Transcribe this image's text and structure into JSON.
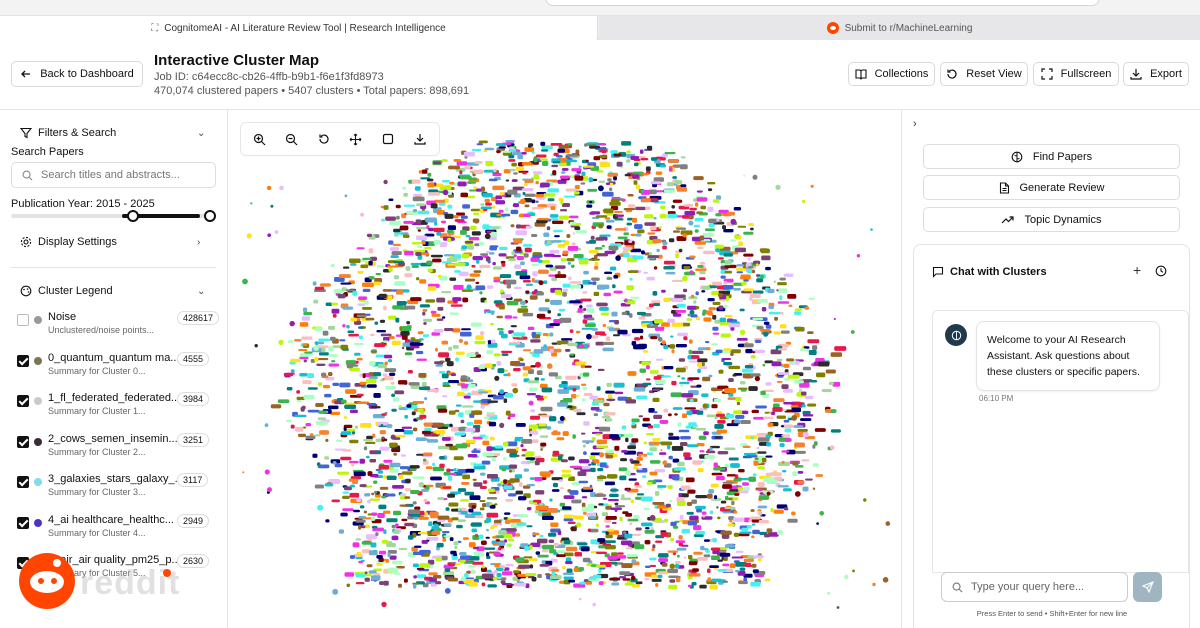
{
  "browser": {
    "tabs": [
      {
        "label": "CognitomeAI - AI Literature Review Tool | Research Intelligence",
        "active": true
      },
      {
        "label": "Submit to r/MachineLearning",
        "active": false
      }
    ]
  },
  "header": {
    "back_label": "Back to Dashboard",
    "title": "Interactive Cluster Map",
    "job_line": "Job ID: c64ecc8c-cb26-4ffb-b9b1-f6e1f3fd8973",
    "stats_line": "470,074 clustered papers • 5407 clusters • Total papers: 898,691",
    "buttons": {
      "collections": "Collections",
      "reset": "Reset View",
      "fullscreen": "Fullscreen",
      "export": "Export"
    }
  },
  "sidebar": {
    "filters_title": "Filters & Search",
    "search_label": "Search Papers",
    "search_placeholder": "Search titles and abstracts...",
    "year_label": "Publication Year: 2015 - 2025",
    "year_range": {
      "min": 2015,
      "max": 2025,
      "from": 2015,
      "to": 2025
    },
    "display_title": "Display Settings",
    "legend_title": "Cluster Legend",
    "legend": [
      {
        "name": "Noise",
        "summary": "Unclustered/noise points...",
        "count": "428617",
        "checked": false,
        "color": "#9a9a9a"
      },
      {
        "name": "0_quantum_quantum ma...",
        "summary": "Summary for Cluster 0...",
        "count": "4555",
        "checked": true,
        "color": "#7a7552"
      },
      {
        "name": "1_fl_federated_federated...",
        "summary": "Summary for Cluster 1...",
        "count": "3984",
        "checked": true,
        "color": "#c9c9c9"
      },
      {
        "name": "2_cows_semen_insemin...",
        "summary": "Summary for Cluster 2...",
        "count": "3251",
        "checked": true,
        "color": "#3a2a38"
      },
      {
        "name": "3_galaxies_stars_galaxy_...",
        "summary": "Summary for Cluster 3...",
        "count": "3117",
        "checked": true,
        "color": "#7fdcec"
      },
      {
        "name": "4_ai healthcare_healthc...",
        "summary": "Summary for Cluster 4...",
        "count": "2949",
        "checked": true,
        "color": "#4a35c9"
      },
      {
        "name": "5_air_air quality_pm25_p...",
        "summary": "Summary for Cluster 5...",
        "count": "2630",
        "checked": true,
        "color": "#d9a34a"
      }
    ]
  },
  "map": {
    "tools": [
      "zoom-in",
      "zoom-out",
      "rotate-reset",
      "pan",
      "select-box",
      "download"
    ],
    "palette": [
      "#e6194b",
      "#3cb44b",
      "#ffe119",
      "#4363d8",
      "#f58231",
      "#911eb4",
      "#46f0f0",
      "#f032e6",
      "#bcf60c",
      "#fabebe",
      "#008080",
      "#e6beff",
      "#9a6324",
      "#800000",
      "#aaffc3",
      "#808000",
      "#000075",
      "#808080",
      "#2b2b2b",
      "#ff7f0e",
      "#17becf",
      "#7b4173",
      "#a1d99b",
      "#6baed6"
    ]
  },
  "right_panel": {
    "actions": {
      "find": "Find Papers",
      "review": "Generate Review",
      "dynamics": "Topic Dynamics"
    },
    "chat": {
      "title": "Chat with Clusters",
      "welcome": "Welcome to your AI Research Assistant. Ask questions about these clusters or specific papers.",
      "time": "06:10 PM",
      "placeholder": "Type your query here...",
      "hint": "Press Enter to send • Shift+Enter for new line"
    }
  },
  "watermark": {
    "text": "reddit"
  }
}
